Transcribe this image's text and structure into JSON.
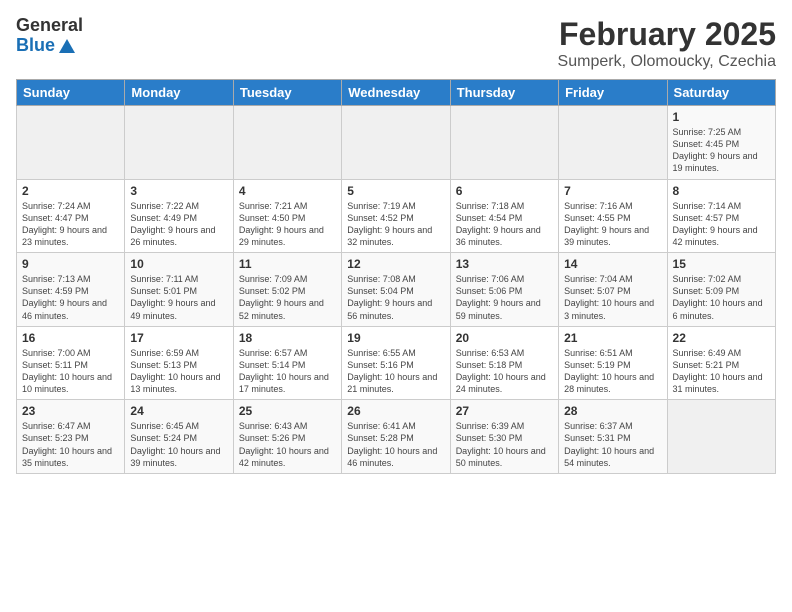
{
  "header": {
    "logo_general": "General",
    "logo_blue": "Blue",
    "title": "February 2025",
    "subtitle": "Sumperk, Olomoucky, Czechia"
  },
  "weekdays": [
    "Sunday",
    "Monday",
    "Tuesday",
    "Wednesday",
    "Thursday",
    "Friday",
    "Saturday"
  ],
  "weeks": [
    [
      {
        "day": "",
        "info": ""
      },
      {
        "day": "",
        "info": ""
      },
      {
        "day": "",
        "info": ""
      },
      {
        "day": "",
        "info": ""
      },
      {
        "day": "",
        "info": ""
      },
      {
        "day": "",
        "info": ""
      },
      {
        "day": "1",
        "info": "Sunrise: 7:25 AM\nSunset: 4:45 PM\nDaylight: 9 hours and 19 minutes."
      }
    ],
    [
      {
        "day": "2",
        "info": "Sunrise: 7:24 AM\nSunset: 4:47 PM\nDaylight: 9 hours and 23 minutes."
      },
      {
        "day": "3",
        "info": "Sunrise: 7:22 AM\nSunset: 4:49 PM\nDaylight: 9 hours and 26 minutes."
      },
      {
        "day": "4",
        "info": "Sunrise: 7:21 AM\nSunset: 4:50 PM\nDaylight: 9 hours and 29 minutes."
      },
      {
        "day": "5",
        "info": "Sunrise: 7:19 AM\nSunset: 4:52 PM\nDaylight: 9 hours and 32 minutes."
      },
      {
        "day": "6",
        "info": "Sunrise: 7:18 AM\nSunset: 4:54 PM\nDaylight: 9 hours and 36 minutes."
      },
      {
        "day": "7",
        "info": "Sunrise: 7:16 AM\nSunset: 4:55 PM\nDaylight: 9 hours and 39 minutes."
      },
      {
        "day": "8",
        "info": "Sunrise: 7:14 AM\nSunset: 4:57 PM\nDaylight: 9 hours and 42 minutes."
      }
    ],
    [
      {
        "day": "9",
        "info": "Sunrise: 7:13 AM\nSunset: 4:59 PM\nDaylight: 9 hours and 46 minutes."
      },
      {
        "day": "10",
        "info": "Sunrise: 7:11 AM\nSunset: 5:01 PM\nDaylight: 9 hours and 49 minutes."
      },
      {
        "day": "11",
        "info": "Sunrise: 7:09 AM\nSunset: 5:02 PM\nDaylight: 9 hours and 52 minutes."
      },
      {
        "day": "12",
        "info": "Sunrise: 7:08 AM\nSunset: 5:04 PM\nDaylight: 9 hours and 56 minutes."
      },
      {
        "day": "13",
        "info": "Sunrise: 7:06 AM\nSunset: 5:06 PM\nDaylight: 9 hours and 59 minutes."
      },
      {
        "day": "14",
        "info": "Sunrise: 7:04 AM\nSunset: 5:07 PM\nDaylight: 10 hours and 3 minutes."
      },
      {
        "day": "15",
        "info": "Sunrise: 7:02 AM\nSunset: 5:09 PM\nDaylight: 10 hours and 6 minutes."
      }
    ],
    [
      {
        "day": "16",
        "info": "Sunrise: 7:00 AM\nSunset: 5:11 PM\nDaylight: 10 hours and 10 minutes."
      },
      {
        "day": "17",
        "info": "Sunrise: 6:59 AM\nSunset: 5:13 PM\nDaylight: 10 hours and 13 minutes."
      },
      {
        "day": "18",
        "info": "Sunrise: 6:57 AM\nSunset: 5:14 PM\nDaylight: 10 hours and 17 minutes."
      },
      {
        "day": "19",
        "info": "Sunrise: 6:55 AM\nSunset: 5:16 PM\nDaylight: 10 hours and 21 minutes."
      },
      {
        "day": "20",
        "info": "Sunrise: 6:53 AM\nSunset: 5:18 PM\nDaylight: 10 hours and 24 minutes."
      },
      {
        "day": "21",
        "info": "Sunrise: 6:51 AM\nSunset: 5:19 PM\nDaylight: 10 hours and 28 minutes."
      },
      {
        "day": "22",
        "info": "Sunrise: 6:49 AM\nSunset: 5:21 PM\nDaylight: 10 hours and 31 minutes."
      }
    ],
    [
      {
        "day": "23",
        "info": "Sunrise: 6:47 AM\nSunset: 5:23 PM\nDaylight: 10 hours and 35 minutes."
      },
      {
        "day": "24",
        "info": "Sunrise: 6:45 AM\nSunset: 5:24 PM\nDaylight: 10 hours and 39 minutes."
      },
      {
        "day": "25",
        "info": "Sunrise: 6:43 AM\nSunset: 5:26 PM\nDaylight: 10 hours and 42 minutes."
      },
      {
        "day": "26",
        "info": "Sunrise: 6:41 AM\nSunset: 5:28 PM\nDaylight: 10 hours and 46 minutes."
      },
      {
        "day": "27",
        "info": "Sunrise: 6:39 AM\nSunset: 5:30 PM\nDaylight: 10 hours and 50 minutes."
      },
      {
        "day": "28",
        "info": "Sunrise: 6:37 AM\nSunset: 5:31 PM\nDaylight: 10 hours and 54 minutes."
      },
      {
        "day": "",
        "info": ""
      }
    ]
  ]
}
